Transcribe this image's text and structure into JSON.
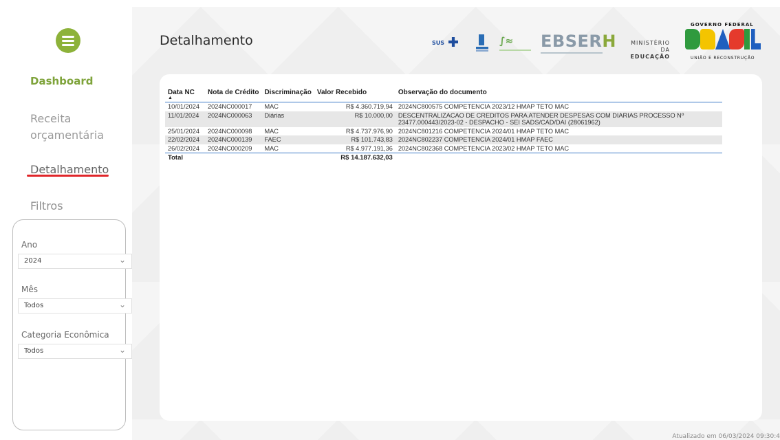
{
  "sidebar": {
    "menu_icon": "hamburger-icon",
    "nav": {
      "dashboard": "Dashboard",
      "receita": "Receita orçamentária",
      "detalhamento": "Detalhamento",
      "filtros": "Filtros"
    },
    "filters": {
      "ano": {
        "label": "Ano",
        "value": "2024"
      },
      "mes": {
        "label": "Mês",
        "value": "Todos"
      },
      "categoria": {
        "label": "Categoria Econômica",
        "value": "Todos"
      }
    }
  },
  "header": {
    "title": "Detalhamento",
    "logos": {
      "sus": "SUS",
      "ebserh": "EBSER",
      "ebserh_h": "H",
      "mec_line1": "MINISTÉRIO DA",
      "mec_line2": "EDUCAÇÃO",
      "gov_top": "GOVERNO FEDERAL",
      "gov_bottom": "UNIÃO E RECONSTRUÇÃO"
    },
    "colors": {
      "gov_green": "#2f9a3e",
      "gov_yellow": "#f4c400",
      "gov_blue": "#1f5fbf",
      "gov_red": "#e53a2c"
    }
  },
  "table": {
    "columns": [
      "Data NC",
      "Nota de Crédito",
      "Discriminação",
      "Valor Recebido",
      "Observação do documento"
    ],
    "rows": [
      {
        "data": "10/01/2024",
        "nota": "2024NC000017",
        "disc": "MAC",
        "valor": "R$ 4.360.719,94",
        "obs": "2024NC800575 COMPETENCIA 2023/12 HMAP TETO MAC"
      },
      {
        "data": "11/01/2024",
        "nota": "2024NC000063",
        "disc": "Diárias",
        "valor": "R$ 10.000,00",
        "obs": "DESCENTRALIZACAO DE CREDITOS PARA ATENDER DESPESAS COM DIARIAS PROCESSO Nº 23477.000443/2023-02 - DESPACHO - SEI SADS/CAD/DAI (28061962)"
      },
      {
        "data": "25/01/2024",
        "nota": "2024NC000098",
        "disc": "MAC",
        "valor": "R$ 4.737.976,90",
        "obs": "2024NC801216 COMPETENCIA 2024/01 HMAP TETO MAC"
      },
      {
        "data": "22/02/2024",
        "nota": "2024NC000139",
        "disc": "FAEC",
        "valor": "R$ 101.743,83",
        "obs": "2024NC802237 COMPETENCIA 2024/01 HMAP FAEC"
      },
      {
        "data": "26/02/2024",
        "nota": "2024NC000209",
        "disc": "MAC",
        "valor": "R$ 4.977.191,36",
        "obs": "2024NC802368 COMPETENCIA 2023/02 HMAP TETO MAC"
      }
    ],
    "total_label": "Total",
    "total_value": "R$ 14.187.632,03"
  },
  "footer": {
    "updated": "Atualizado em 06/03/2024 09:30:4"
  }
}
